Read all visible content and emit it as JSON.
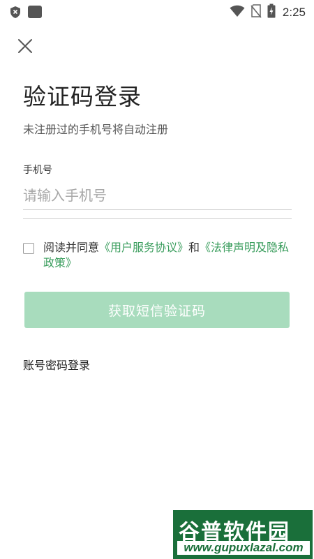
{
  "status_bar": {
    "time": "2:25",
    "icons_left": [
      "shield-icon",
      "app-icon"
    ],
    "icons_right": [
      "wifi-icon",
      "no-sim-icon",
      "battery-charging-icon"
    ]
  },
  "header": {
    "close_icon": "close-icon"
  },
  "title": "验证码登录",
  "subtitle": "未注册过的手机号将自动注册",
  "phone": {
    "label": "手机号",
    "placeholder": "请输入手机号",
    "value": ""
  },
  "agreement": {
    "checked": false,
    "prefix": "阅读并同意",
    "link1": "《用户服务协议》",
    "connector": "和",
    "link2": "《法律声明及隐私政策》"
  },
  "sms_button": {
    "label": "获取短信验证码",
    "enabled": false
  },
  "password_login": "账号密码登录",
  "watermark": {
    "main": "谷普软件园",
    "url": "www.gupuxlazal.com"
  },
  "colors": {
    "accent": "#3a9d5d",
    "button_disabled": "#a8dcbd",
    "watermark_bg": "#1a6f3a"
  }
}
